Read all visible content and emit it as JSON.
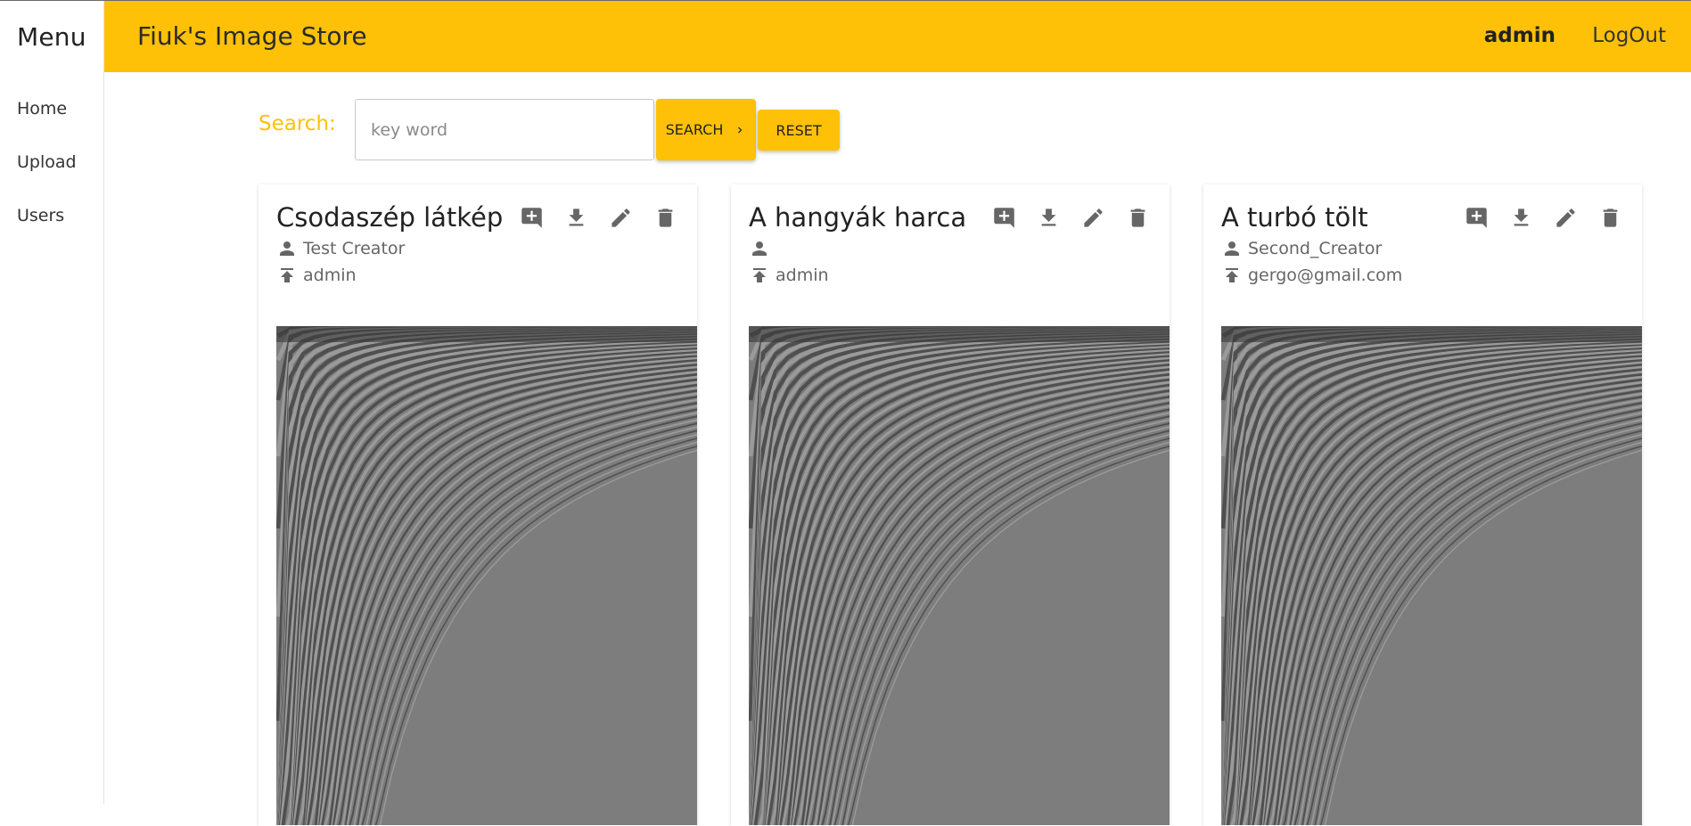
{
  "sidebar": {
    "title": "Menu",
    "items": [
      {
        "label": "Home"
      },
      {
        "label": "Upload"
      },
      {
        "label": "Users"
      }
    ]
  },
  "header": {
    "app_title": "Fiuk's Image Store",
    "user": "admin",
    "logout_label": "LogOut"
  },
  "search": {
    "label": "Search:",
    "placeholder": "key word",
    "value": "",
    "search_button": "SEARCH",
    "reset_button": "RESET"
  },
  "icons": {
    "add_comment": "add-comment-icon",
    "download": "download-icon",
    "edit": "edit-icon",
    "delete": "delete-icon",
    "creator": "person-icon",
    "uploader": "upload-icon"
  },
  "colors": {
    "accent": "#ffc107",
    "icon": "#666666"
  },
  "cards": [
    {
      "title": "Csodaszép látkép",
      "creator": "Test Creator",
      "uploader": "admin"
    },
    {
      "title": "A hangyák harca",
      "creator": "",
      "uploader": "admin"
    },
    {
      "title": "A turbó tölt",
      "creator": "Second_Creator",
      "uploader": "gergo@gmail.com"
    }
  ]
}
